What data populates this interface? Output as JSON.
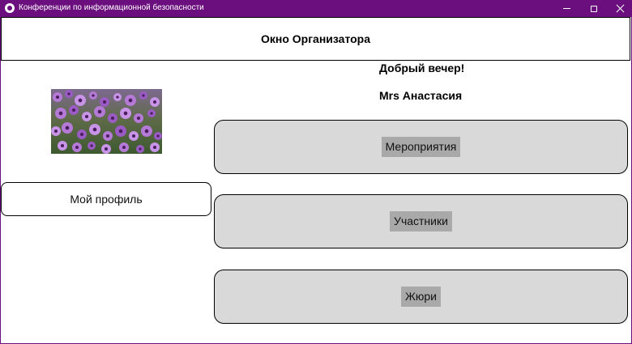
{
  "window": {
    "title": "Конференции по информационной безопасности",
    "accent_color": "#6b0f7e",
    "controls": [
      "minimize-icon",
      "maximize-icon",
      "close-icon"
    ]
  },
  "header": {
    "title": "Окно Организатора"
  },
  "user": {
    "greeting": "Добрый вечер!",
    "name": "Mrs Анастасия"
  },
  "sidebar": {
    "photo": "purple-flowers-image",
    "profile_button": "Мой профиль"
  },
  "menu": {
    "items": [
      {
        "label": "Мероприятия"
      },
      {
        "label": "Участники"
      },
      {
        "label": "Жюри"
      }
    ]
  }
}
